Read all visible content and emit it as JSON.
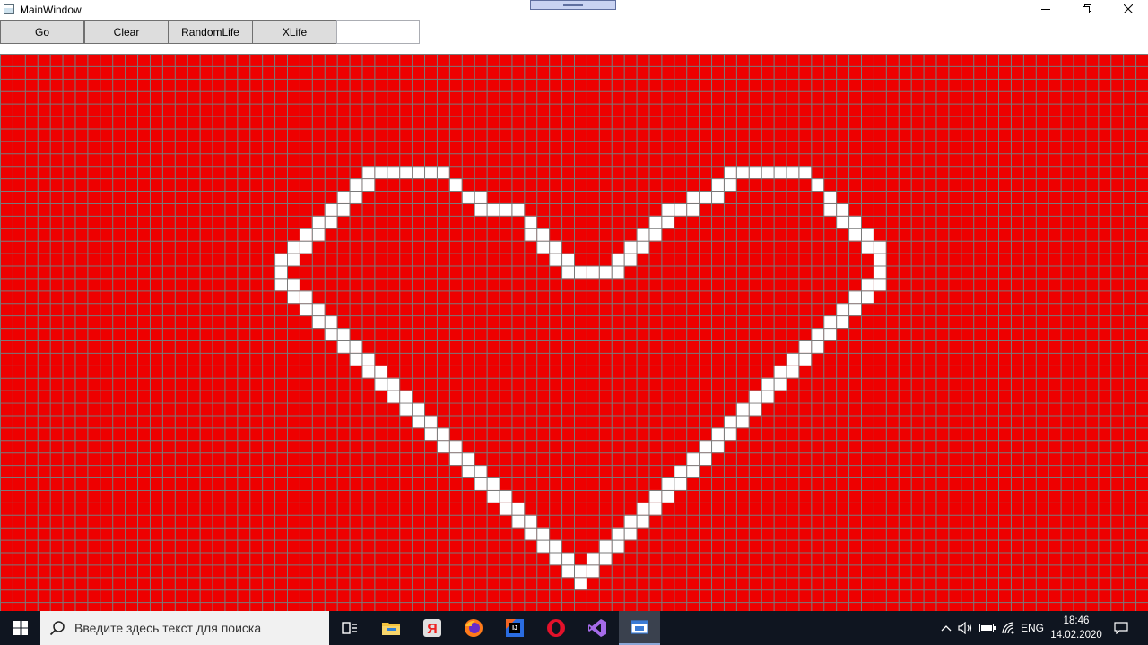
{
  "window": {
    "title": "MainWindow"
  },
  "toolbar": {
    "go_label": "Go",
    "clear_label": "Clear",
    "random_label": "RandomLife",
    "xlife_label": "XLife",
    "input_value": ""
  },
  "board": {
    "columns": 92,
    "rows": 45,
    "alive_color": "#ffffff",
    "dead_color": "#ee0000",
    "gridline_color": "#7a7a7a",
    "alive_cells": [
      [
        29,
        9
      ],
      [
        30,
        9
      ],
      [
        31,
        9
      ],
      [
        32,
        9
      ],
      [
        33,
        9
      ],
      [
        34,
        9
      ],
      [
        35,
        9
      ],
      [
        58,
        9
      ],
      [
        59,
        9
      ],
      [
        60,
        9
      ],
      [
        61,
        9
      ],
      [
        62,
        9
      ],
      [
        63,
        9
      ],
      [
        64,
        9
      ],
      [
        28,
        10
      ],
      [
        29,
        10
      ],
      [
        36,
        10
      ],
      [
        57,
        10
      ],
      [
        58,
        10
      ],
      [
        65,
        10
      ],
      [
        27,
        11
      ],
      [
        28,
        11
      ],
      [
        37,
        11
      ],
      [
        38,
        11
      ],
      [
        55,
        11
      ],
      [
        56,
        11
      ],
      [
        57,
        11
      ],
      [
        66,
        11
      ],
      [
        26,
        12
      ],
      [
        27,
        12
      ],
      [
        38,
        12
      ],
      [
        39,
        12
      ],
      [
        40,
        12
      ],
      [
        41,
        12
      ],
      [
        53,
        12
      ],
      [
        54,
        12
      ],
      [
        55,
        12
      ],
      [
        66,
        12
      ],
      [
        67,
        12
      ],
      [
        25,
        13
      ],
      [
        26,
        13
      ],
      [
        42,
        13
      ],
      [
        52,
        13
      ],
      [
        53,
        13
      ],
      [
        67,
        13
      ],
      [
        68,
        13
      ],
      [
        24,
        14
      ],
      [
        25,
        14
      ],
      [
        42,
        14
      ],
      [
        43,
        14
      ],
      [
        51,
        14
      ],
      [
        52,
        14
      ],
      [
        68,
        14
      ],
      [
        69,
        14
      ],
      [
        23,
        15
      ],
      [
        24,
        15
      ],
      [
        43,
        15
      ],
      [
        44,
        15
      ],
      [
        50,
        15
      ],
      [
        51,
        15
      ],
      [
        69,
        15
      ],
      [
        70,
        15
      ],
      [
        22,
        16
      ],
      [
        23,
        16
      ],
      [
        44,
        16
      ],
      [
        45,
        16
      ],
      [
        49,
        16
      ],
      [
        50,
        16
      ],
      [
        70,
        16
      ],
      [
        22,
        17
      ],
      [
        45,
        17
      ],
      [
        46,
        17
      ],
      [
        47,
        17
      ],
      [
        48,
        17
      ],
      [
        49,
        17
      ],
      [
        70,
        17
      ],
      [
        22,
        18
      ],
      [
        23,
        18
      ],
      [
        69,
        18
      ],
      [
        70,
        18
      ],
      [
        23,
        19
      ],
      [
        24,
        19
      ],
      [
        68,
        19
      ],
      [
        69,
        19
      ],
      [
        24,
        20
      ],
      [
        25,
        20
      ],
      [
        67,
        20
      ],
      [
        68,
        20
      ],
      [
        25,
        21
      ],
      [
        26,
        21
      ],
      [
        66,
        21
      ],
      [
        67,
        21
      ],
      [
        26,
        22
      ],
      [
        27,
        22
      ],
      [
        65,
        22
      ],
      [
        66,
        22
      ],
      [
        27,
        23
      ],
      [
        28,
        23
      ],
      [
        64,
        23
      ],
      [
        65,
        23
      ],
      [
        28,
        24
      ],
      [
        29,
        24
      ],
      [
        63,
        24
      ],
      [
        64,
        24
      ],
      [
        29,
        25
      ],
      [
        30,
        25
      ],
      [
        62,
        25
      ],
      [
        63,
        25
      ],
      [
        30,
        26
      ],
      [
        31,
        26
      ],
      [
        61,
        26
      ],
      [
        62,
        26
      ],
      [
        31,
        27
      ],
      [
        32,
        27
      ],
      [
        60,
        27
      ],
      [
        61,
        27
      ],
      [
        32,
        28
      ],
      [
        33,
        28
      ],
      [
        59,
        28
      ],
      [
        60,
        28
      ],
      [
        33,
        29
      ],
      [
        34,
        29
      ],
      [
        58,
        29
      ],
      [
        59,
        29
      ],
      [
        34,
        30
      ],
      [
        35,
        30
      ],
      [
        57,
        30
      ],
      [
        58,
        30
      ],
      [
        35,
        31
      ],
      [
        36,
        31
      ],
      [
        56,
        31
      ],
      [
        57,
        31
      ],
      [
        36,
        32
      ],
      [
        37,
        32
      ],
      [
        55,
        32
      ],
      [
        56,
        32
      ],
      [
        37,
        33
      ],
      [
        38,
        33
      ],
      [
        54,
        33
      ],
      [
        55,
        33
      ],
      [
        38,
        34
      ],
      [
        39,
        34
      ],
      [
        53,
        34
      ],
      [
        54,
        34
      ],
      [
        39,
        35
      ],
      [
        40,
        35
      ],
      [
        52,
        35
      ],
      [
        53,
        35
      ],
      [
        40,
        36
      ],
      [
        41,
        36
      ],
      [
        51,
        36
      ],
      [
        52,
        36
      ],
      [
        41,
        37
      ],
      [
        42,
        37
      ],
      [
        50,
        37
      ],
      [
        51,
        37
      ],
      [
        42,
        38
      ],
      [
        43,
        38
      ],
      [
        49,
        38
      ],
      [
        50,
        38
      ],
      [
        43,
        39
      ],
      [
        44,
        39
      ],
      [
        48,
        39
      ],
      [
        49,
        39
      ],
      [
        44,
        40
      ],
      [
        45,
        40
      ],
      [
        47,
        40
      ],
      [
        48,
        40
      ],
      [
        45,
        41
      ],
      [
        46,
        41
      ],
      [
        47,
        41
      ],
      [
        46,
        42
      ]
    ]
  },
  "taskbar": {
    "search_placeholder": "Введите здесь текст для поиска",
    "apps": [
      "task-view",
      "file-explorer",
      "yandex-browser",
      "firefox",
      "jetbrains-ide",
      "opera",
      "visual-studio",
      "mainwindow-app"
    ],
    "tray": {
      "language": "ENG",
      "time": "18:46",
      "date": "14.02.2020"
    }
  }
}
